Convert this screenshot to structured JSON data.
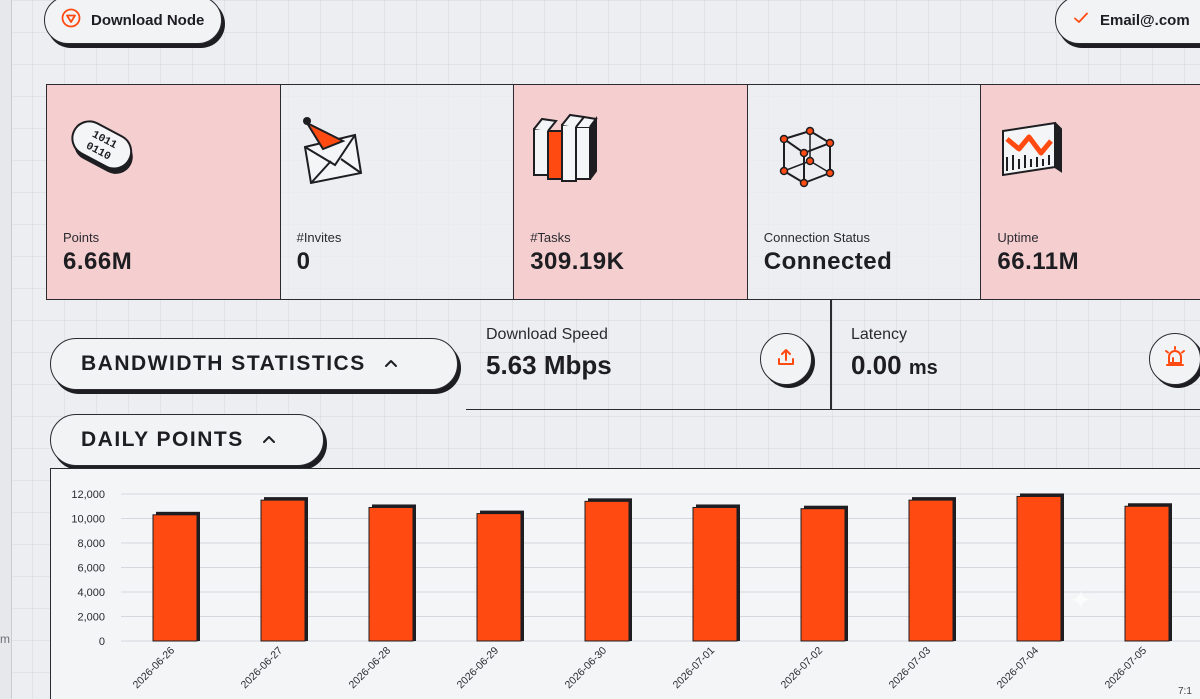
{
  "header": {
    "download_node_label": "Download Node",
    "email_label": "Email@.com"
  },
  "left_edge_text": "m",
  "stats": [
    {
      "label": "Points",
      "value": "6.66M",
      "icon": "binary-pill-icon",
      "highlight": true
    },
    {
      "label": "#Invites",
      "value": "0",
      "icon": "envelope-pin-icon",
      "highlight": false
    },
    {
      "label": "#Tasks",
      "value": "309.19K",
      "icon": "books-icon",
      "highlight": true
    },
    {
      "label": "Connection Status",
      "value": "Connected",
      "icon": "cube-network-icon",
      "highlight": false
    },
    {
      "label": "Uptime",
      "value": "66.11M",
      "icon": "uptime-chart-icon",
      "highlight": true
    }
  ],
  "bandwidth": {
    "section_label": "BANDWIDTH STATISTICS",
    "download_label": "Download Speed",
    "download_value": "5.63 Mbps",
    "latency_label": "Latency",
    "latency_value": "0.00",
    "latency_unit": "ms"
  },
  "daily_points": {
    "section_label": "DAILY POINTS"
  },
  "colors": {
    "accent": "#ff4a12",
    "card_pink": "#f5cfcf",
    "ink": "#1d1d22"
  },
  "taskbar_time": "7:1",
  "chart_data": {
    "type": "bar",
    "categories": [
      "2026-06-26",
      "2026-06-27",
      "2026-06-28",
      "2026-06-29",
      "2026-06-30",
      "2026-07-01",
      "2026-07-02",
      "2026-07-03",
      "2026-07-04",
      "2026-07-05"
    ],
    "values": [
      10300,
      11500,
      10900,
      10400,
      11400,
      10900,
      10800,
      11500,
      11800,
      11000
    ],
    "yticks": [
      "0",
      "2,000",
      "4,000",
      "6,000",
      "8,000",
      "10,000",
      "12,000"
    ],
    "ylim": [
      0,
      12000
    ],
    "title": "",
    "xlabel": "",
    "ylabel": "",
    "grid": true
  }
}
